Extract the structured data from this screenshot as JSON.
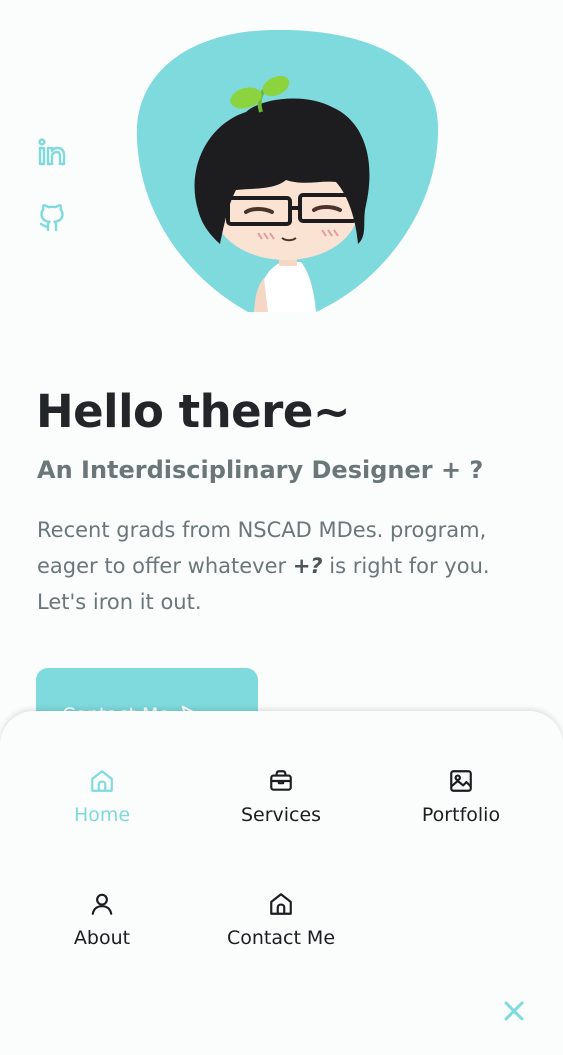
{
  "social": {
    "icons": [
      "linkedin-icon",
      "github-icon"
    ]
  },
  "hero": {
    "title": "Hello there~",
    "subtitle": "An Interdisciplinary Designer + ?",
    "desc_part1": "Recent grads from NSCAD MDes. program, eager to offer whatever ",
    "desc_em": "+?",
    "desc_part2": " is right for you. Let's iron it out.",
    "contact_button": "Contact Me"
  },
  "menu": {
    "items": [
      {
        "label": "Home",
        "icon": "home-icon",
        "active": true
      },
      {
        "label": "Services",
        "icon": "briefcase-icon",
        "active": false
      },
      {
        "label": "Portfolio",
        "icon": "image-icon",
        "active": false
      },
      {
        "label": "About",
        "icon": "user-icon",
        "active": false
      },
      {
        "label": "Contact Me",
        "icon": "home-icon",
        "active": false
      }
    ],
    "close_icon": "close-icon"
  },
  "colors": {
    "accent": "#7fdadd",
    "heading": "#232628",
    "muted": "#6a7678"
  }
}
